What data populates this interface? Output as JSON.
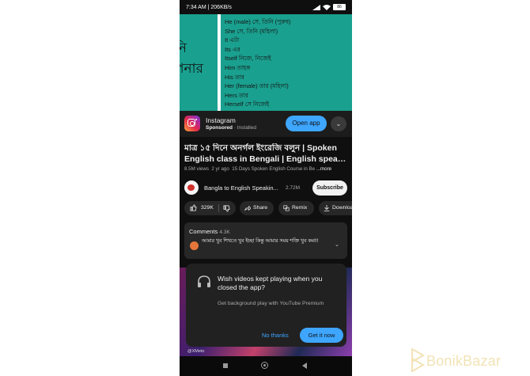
{
  "status_bar": {
    "time_speed": "7:34 AM | 206KB/s",
    "signal_icons": "signal-wifi-icons",
    "battery": "86"
  },
  "video_frame": {
    "bengali_left": [
      "নি",
      "পনার"
    ],
    "lines": [
      "He (male) সে, তিনি (পুরুষ)",
      "She   সে, তিনি (মহিলা)",
      "It    এটা",
      "Its    এর",
      "Itself        নিজে, নিজেই",
      "Him  তাহক",
      "His   তার",
      "Her (female)       তার (মহিলা)",
      "Hers তার",
      "Herself      সে নিজেই"
    ]
  },
  "ad": {
    "app_name": "Instagram",
    "sponsored": "Sponsored",
    "installed": " · Installed",
    "open_label": "Open app",
    "chevron": "⌄"
  },
  "video": {
    "title_lines": [
      "মাত্র ১৫ দিনে অনর্গল ইংরেজি বলুন | Spoken",
      "English class in Bengali | English speaking c..."
    ],
    "views": "8.5M views",
    "age": "2 yr ago",
    "hashtag": "15 Days Spoken English Course in Be",
    "more": "...more"
  },
  "channel": {
    "name": "Bangla to English Speakin...",
    "subs": "2.72M",
    "subscribe_label": "Subscribe"
  },
  "actions": {
    "likes": "329K",
    "share": "Share",
    "remix": "Remix",
    "download": "Download"
  },
  "comments": {
    "label": "Comments",
    "count": "4.3K",
    "text": "আমার খুব শিখতে খুব ইচ্ছা কিন্তু আমার সময় শক্তি খুব কম!!!",
    "chev": "⌄"
  },
  "dialog": {
    "title": "Wish videos kept playing when you closed the app?",
    "subtitle": "Get background play with YouTube Premium",
    "no_label": "No thanks",
    "yes_label": "Get it now"
  },
  "bg_caption": "@XMeto",
  "watermark": {
    "text": "BonikBazar",
    "color": "#f2e3b5"
  },
  "colors": {
    "accent": "#3ea6ff",
    "video_bg": "#1aa08f",
    "app_bg": "#0f0f0f"
  }
}
